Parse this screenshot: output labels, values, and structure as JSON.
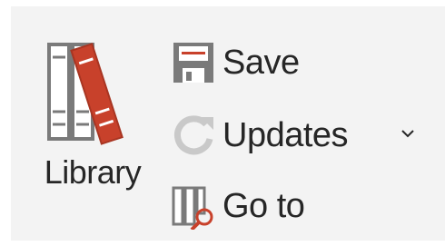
{
  "group": {
    "library_label": "Library",
    "commands": {
      "save_label": "Save",
      "updates_label": "Updates",
      "goto_label": "Go to"
    }
  },
  "icons": {
    "library": "library-books-icon",
    "save": "floppy-disk-icon",
    "updates": "refresh-icon",
    "goto": "books-search-icon",
    "dropdown": "chevron-down-icon"
  },
  "colors": {
    "background": "#f3f3f3",
    "text": "#262626",
    "accent_red": "#c8412b",
    "icon_gray": "#7a7a7a",
    "disabled_gray": "#c9c9c9"
  }
}
